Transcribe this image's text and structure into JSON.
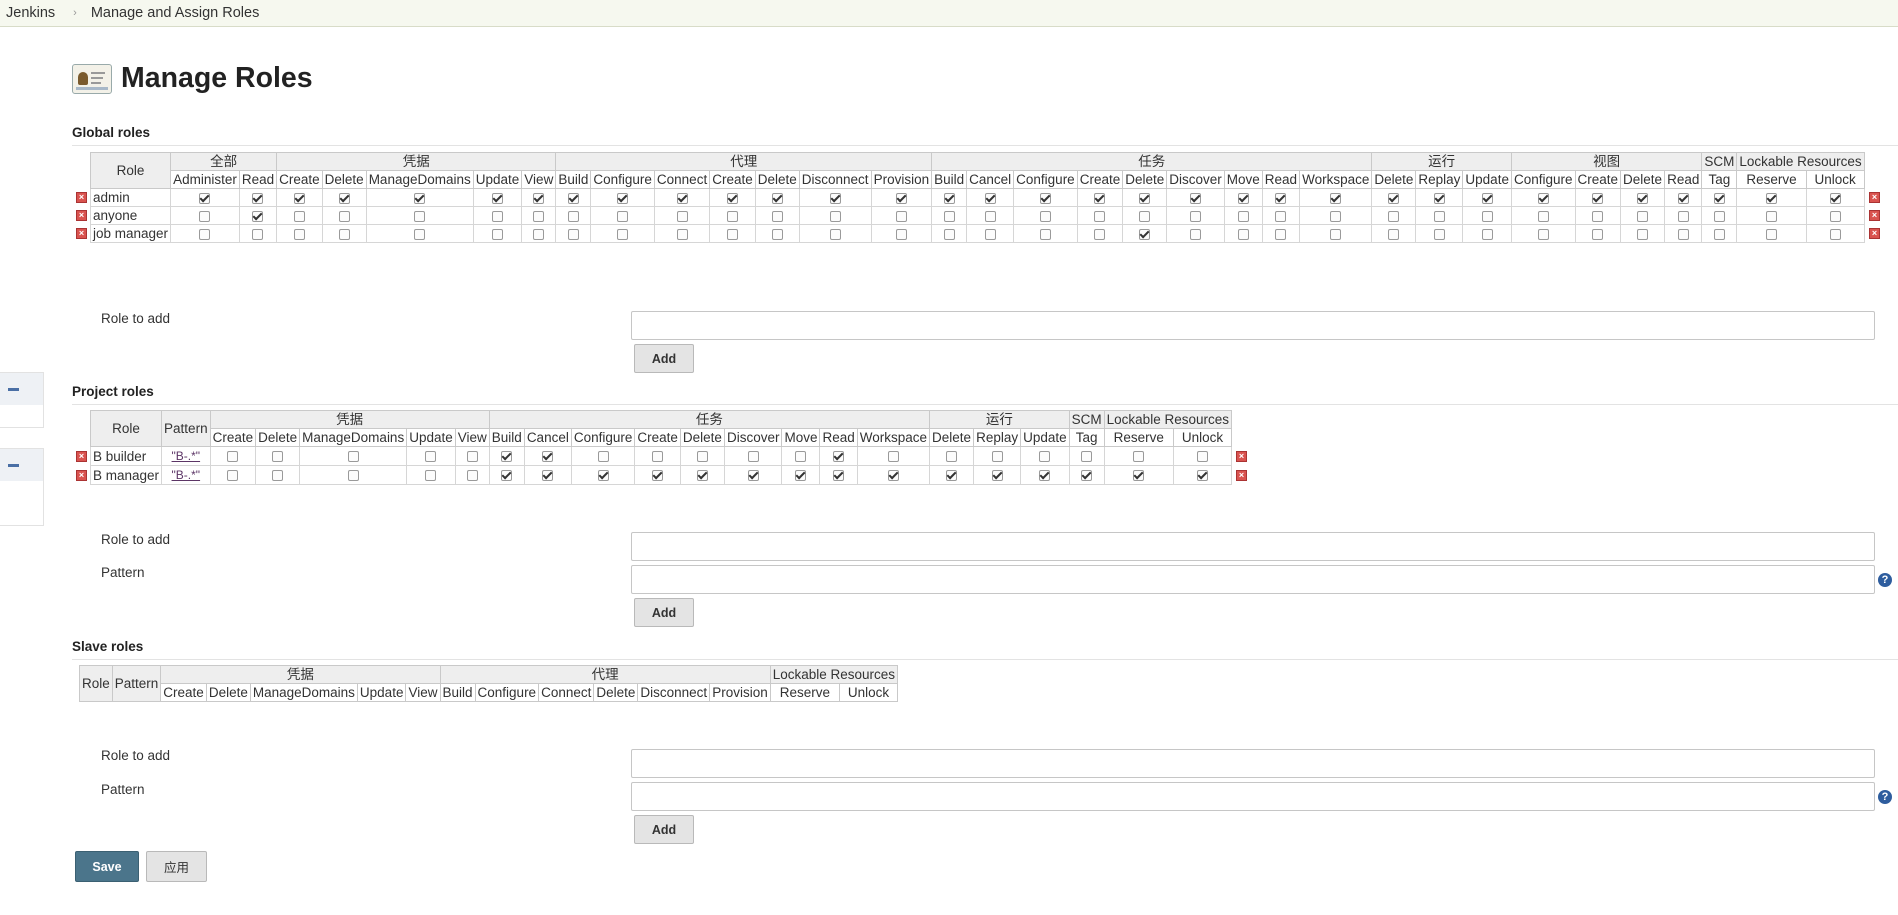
{
  "breadcrumb": {
    "root": "Jenkins",
    "current": "Manage and Assign Roles"
  },
  "page": {
    "title": "Manage Roles"
  },
  "global": {
    "heading": "Global roles",
    "role_header": "Role",
    "groups": [
      {
        "name": "全部",
        "perms": [
          "Administer",
          "Read"
        ]
      },
      {
        "name": "凭据",
        "perms": [
          "Create",
          "Delete",
          "ManageDomains",
          "Update",
          "View"
        ]
      },
      {
        "name": "代理",
        "perms": [
          "Build",
          "Configure",
          "Connect",
          "Create",
          "Delete",
          "Disconnect",
          "Provision"
        ]
      },
      {
        "name": "任务",
        "perms": [
          "Build",
          "Cancel",
          "Configure",
          "Create",
          "Delete",
          "Discover",
          "Move",
          "Read",
          "Workspace"
        ]
      },
      {
        "name": "运行",
        "perms": [
          "Delete",
          "Replay",
          "Update"
        ]
      },
      {
        "name": "视图",
        "perms": [
          "Configure",
          "Create",
          "Delete",
          "Read"
        ]
      },
      {
        "name": "SCM",
        "perms": [
          "Tag"
        ]
      },
      {
        "name": "Lockable Resources",
        "perms": [
          "Reserve",
          "Unlock"
        ]
      }
    ],
    "rows": [
      {
        "name": "admin",
        "checked": [
          1,
          1,
          1,
          1,
          1,
          1,
          1,
          1,
          1,
          1,
          1,
          1,
          1,
          1,
          1,
          1,
          1,
          1,
          1,
          1,
          1,
          1,
          1,
          1,
          1,
          1,
          1,
          1,
          1,
          1,
          1,
          1,
          1
        ]
      },
      {
        "name": "anyone",
        "checked": [
          0,
          1,
          0,
          0,
          0,
          0,
          0,
          0,
          0,
          0,
          0,
          0,
          0,
          0,
          0,
          0,
          0,
          0,
          0,
          0,
          0,
          0,
          0,
          0,
          0,
          0,
          0,
          0,
          0,
          0,
          0,
          0,
          0
        ]
      },
      {
        "name": "job manager",
        "checked": [
          0,
          0,
          0,
          0,
          0,
          0,
          0,
          0,
          0,
          0,
          0,
          0,
          0,
          0,
          0,
          0,
          0,
          0,
          1,
          0,
          0,
          0,
          0,
          0,
          0,
          0,
          0,
          0,
          0,
          0,
          0,
          0,
          0
        ]
      }
    ],
    "role_to_add_label": "Role to add",
    "add_label": "Add"
  },
  "project": {
    "heading": "Project roles",
    "role_header": "Role",
    "pattern_header": "Pattern",
    "groups": [
      {
        "name": "凭据",
        "perms": [
          "Create",
          "Delete",
          "ManageDomains",
          "Update",
          "View"
        ]
      },
      {
        "name": "任务",
        "perms": [
          "Build",
          "Cancel",
          "Configure",
          "Create",
          "Delete",
          "Discover",
          "Move",
          "Read",
          "Workspace"
        ]
      },
      {
        "name": "运行",
        "perms": [
          "Delete",
          "Replay",
          "Update"
        ]
      },
      {
        "name": "SCM",
        "perms": [
          "Tag"
        ]
      },
      {
        "name": "Lockable Resources",
        "perms": [
          "Reserve",
          "Unlock"
        ]
      }
    ],
    "rows": [
      {
        "name": "B builder",
        "pattern": "\"B-.*\"",
        "checked": [
          0,
          0,
          0,
          0,
          0,
          1,
          1,
          0,
          0,
          0,
          0,
          0,
          1,
          0,
          0,
          0,
          0,
          0,
          0,
          0
        ]
      },
      {
        "name": "B manager",
        "pattern": "\"B-.*\"",
        "checked": [
          0,
          0,
          0,
          0,
          0,
          1,
          1,
          1,
          1,
          1,
          1,
          1,
          1,
          1,
          1,
          1,
          1,
          1,
          1,
          1
        ]
      }
    ],
    "role_to_add_label": "Role to add",
    "pattern_label": "Pattern",
    "add_label": "Add"
  },
  "slave": {
    "heading": "Slave roles",
    "role_header": "Role",
    "pattern_header": "Pattern",
    "groups": [
      {
        "name": "凭据",
        "perms": [
          "Create",
          "Delete",
          "ManageDomains",
          "Update",
          "View"
        ]
      },
      {
        "name": "代理",
        "perms": [
          "Build",
          "Configure",
          "Connect",
          "Delete",
          "Disconnect",
          "Provision"
        ]
      },
      {
        "name": "Lockable Resources",
        "perms": [
          "Reserve",
          "Unlock"
        ]
      }
    ],
    "rows": [],
    "role_to_add_label": "Role to add",
    "pattern_label": "Pattern",
    "add_label": "Add"
  },
  "actions": {
    "save": "Save",
    "apply": "应用"
  },
  "icons": {
    "delete": "delete-icon",
    "help": "help-icon",
    "collapse": "minus-icon",
    "title": "roles-icon"
  },
  "colors": {
    "save_bg": "#4b758b",
    "delete_red": "#d9534f",
    "help_blue": "#2e5d9e",
    "link_purple": "#5c3566"
  }
}
